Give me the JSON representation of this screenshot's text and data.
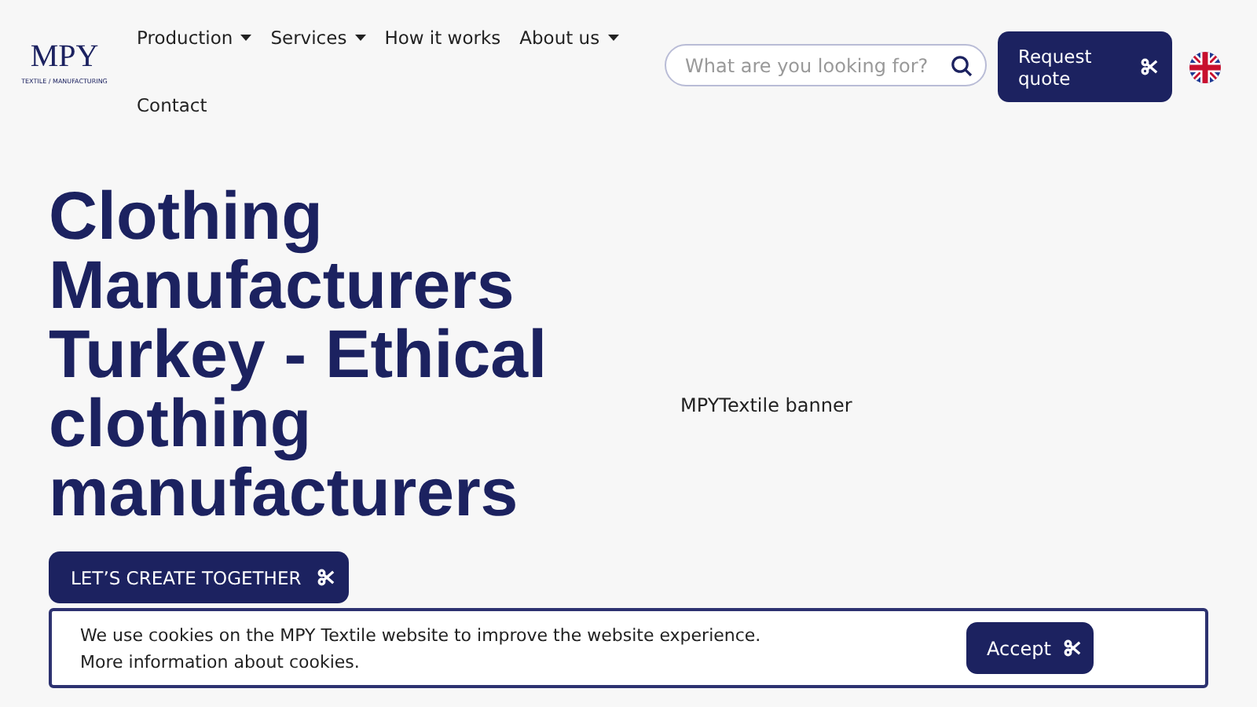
{
  "logo": {
    "mark": "MPY",
    "tagline": "TEXTILE / MANUFACTURING"
  },
  "nav": [
    {
      "label": "Production",
      "has_menu": true
    },
    {
      "label": "Services",
      "has_menu": true
    },
    {
      "label": "How it works",
      "has_menu": false
    },
    {
      "label": "About us",
      "has_menu": true
    },
    {
      "label": "Contact",
      "has_menu": false
    }
  ],
  "search": {
    "placeholder": "What are you looking for?"
  },
  "quote_button": "Request quote",
  "hero": {
    "title": "Clothing Manufacturers Turkey - Ethical clothing manufacturers",
    "button": "LET’S CREATE TOGETHER",
    "banner_alt": "MPYTextile banner"
  },
  "cookie": {
    "text": "We use cookies on the MPY Textile website to improve the website experience. More information about cookies.",
    "button": "Accept"
  }
}
